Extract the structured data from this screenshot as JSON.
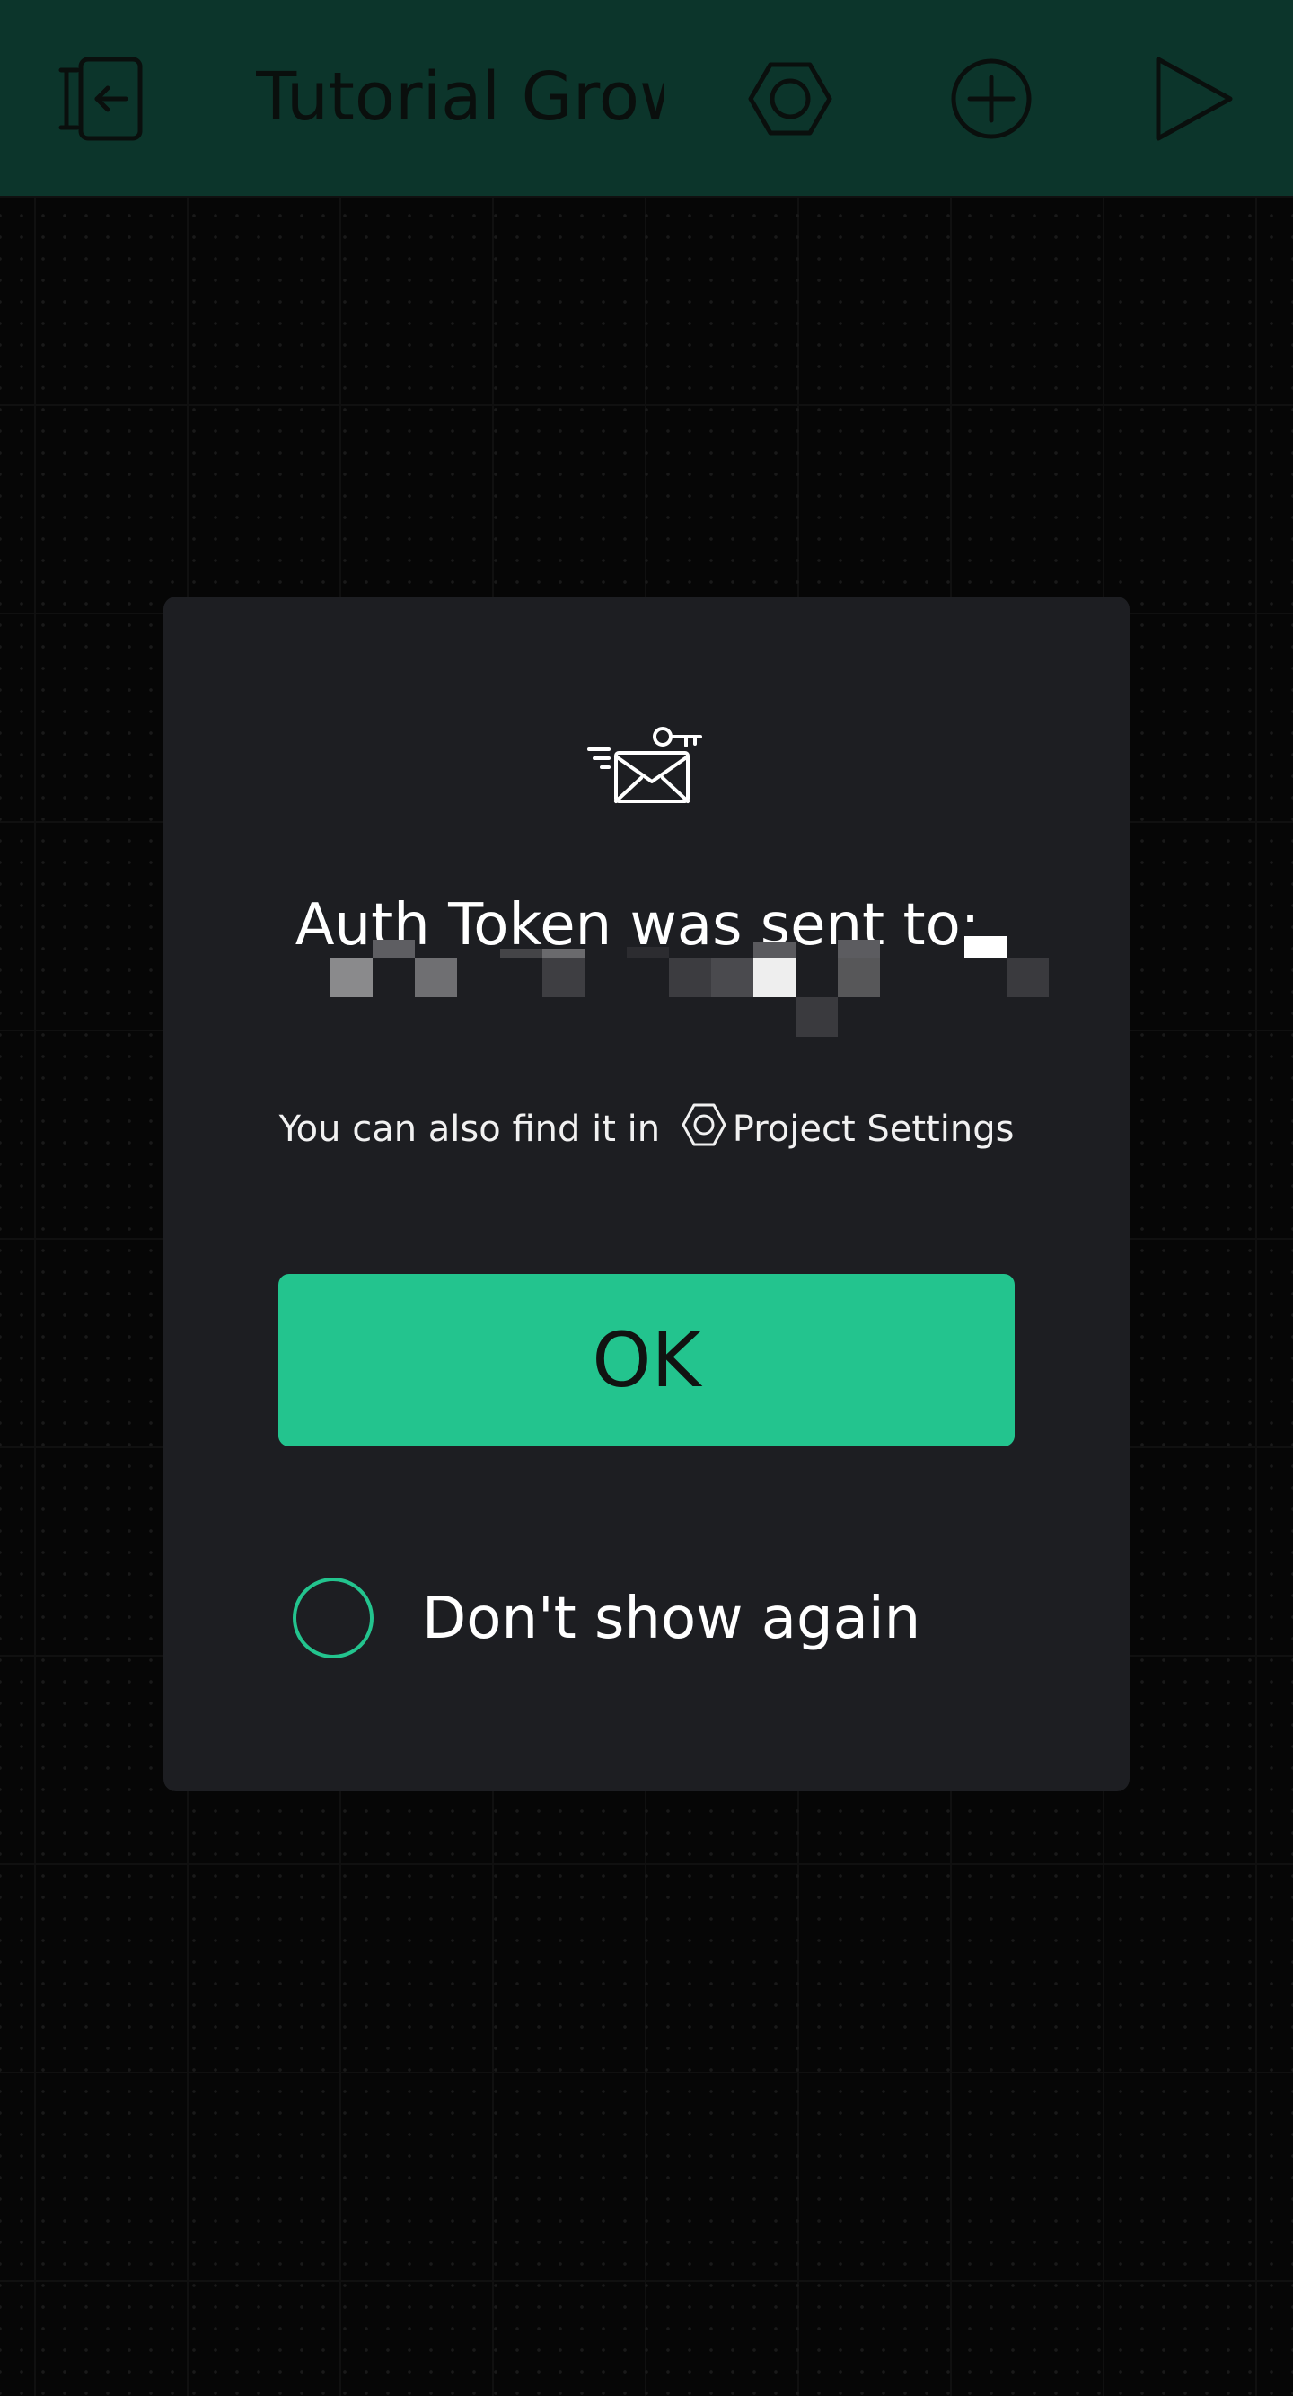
{
  "header": {
    "title": "Tutorial Growt"
  },
  "icons": {
    "back": "exit-back-icon",
    "settings": "hexagon-settings-icon",
    "add": "plus-circle-icon",
    "play": "play-icon",
    "mail": "mail-key-icon",
    "radio": "radio-circle-icon"
  },
  "dialog": {
    "message": "Auth Token was sent to:",
    "hint_prefix": "You can also find it in",
    "hint_link": "Project Settings",
    "ok_label": "OK",
    "dont_show_label": "Don't show again"
  },
  "colors": {
    "app_bar": "#0c352b",
    "dialog_bg": "#1d1e22",
    "accent": "#23c48e",
    "canvas_bg": "#060606"
  }
}
